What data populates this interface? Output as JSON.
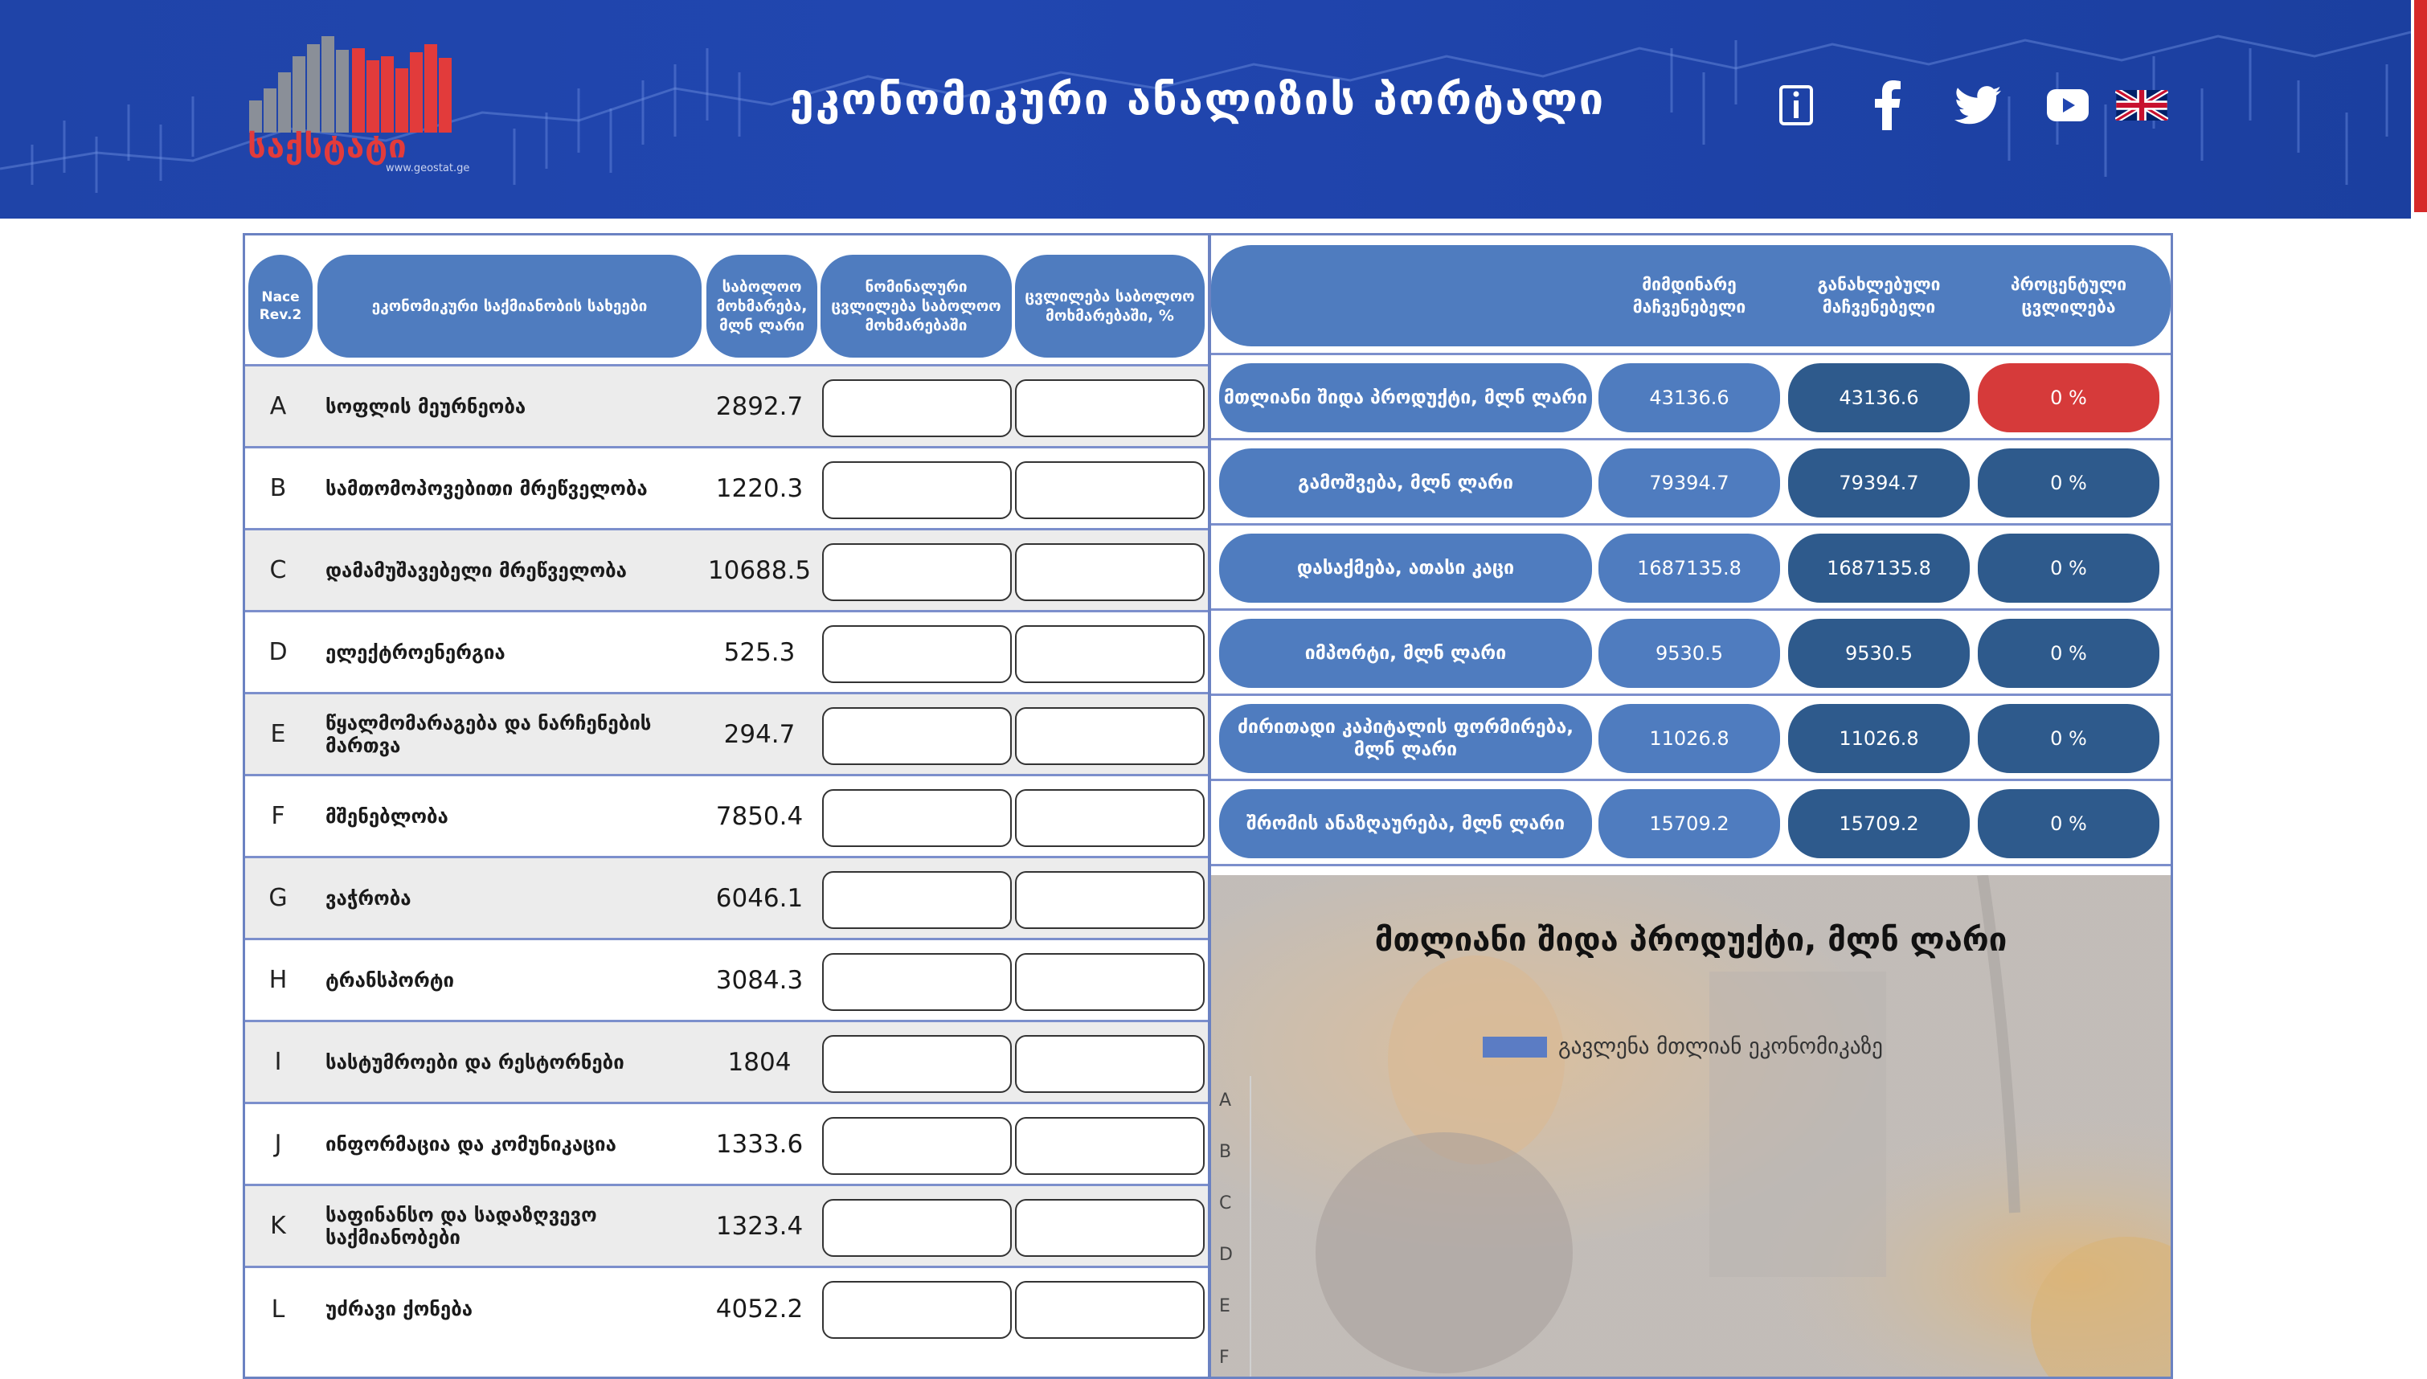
{
  "header": {
    "logo_text": "საქსტატი",
    "logo_url": "www.geostat.ge",
    "title": "ეკონომიკური ანალიზის პორტალი",
    "icons": [
      "info-icon",
      "facebook-icon",
      "twitter-icon",
      "youtube-icon",
      "uk-flag-icon"
    ],
    "colors": {
      "background": "#2146b0",
      "accent_red": "#d62a2a"
    }
  },
  "left_table": {
    "headers": {
      "code": "Nace Rev.2",
      "name": "ეკონომიკური საქმიანობის სახეები",
      "final_consumption": "საბოლოო მოხმარება, მლნ ლარი",
      "nominal_change": "ნომინალური ცვლილება საბოლოო მოხმარებაში",
      "change_pct": "ცვლილება საბოლოო მოხმარებაში, %"
    },
    "rows": [
      {
        "code": "A",
        "name": "სოფლის მეურნეობა",
        "value": "2892.7"
      },
      {
        "code": "B",
        "name": "სამთომოპოვებითი მრეწველობა",
        "value": "1220.3"
      },
      {
        "code": "C",
        "name": "დამამუშავებელი მრეწველობა",
        "value": "10688.5"
      },
      {
        "code": "D",
        "name": "ელექტროენერგია",
        "value": "525.3"
      },
      {
        "code": "E",
        "name": "წყალმომარაგება და ნარჩენების მართვა",
        "value": "294.7"
      },
      {
        "code": "F",
        "name": "მშენებლობა",
        "value": "7850.4"
      },
      {
        "code": "G",
        "name": "ვაჭრობა",
        "value": "6046.1"
      },
      {
        "code": "H",
        "name": "ტრანსპორტი",
        "value": "3084.3"
      },
      {
        "code": "I",
        "name": "სასტუმროები და რესტორნები",
        "value": "1804"
      },
      {
        "code": "J",
        "name": "ინფორმაცია და კომუნიკაცია",
        "value": "1333.6"
      },
      {
        "code": "K",
        "name": "საფინანსო და სადაზღვევო საქმიანობები",
        "value": "1323.4"
      },
      {
        "code": "L",
        "name": "უძრავი ქონება",
        "value": "4052.2"
      }
    ]
  },
  "indicators": {
    "headers": {
      "current": "მიმდინარე მაჩვენებელი",
      "updated": "განახლებული მაჩვენებელი",
      "pct_change": "პროცენტული ცვლილება"
    },
    "rows": [
      {
        "label": "მთლიანი შიდა პროდუქტი, მლნ ლარი",
        "current": "43136.6",
        "updated": "43136.6",
        "pct": "0 %"
      },
      {
        "label": "გამოშვება, მლნ ლარი",
        "current": "79394.7",
        "updated": "79394.7",
        "pct": "0 %"
      },
      {
        "label": "დასაქმება, ათასი კაცი",
        "current": "1687135.8",
        "updated": "1687135.8",
        "pct": "0 %"
      },
      {
        "label": "იმპორტი, მლნ ლარი",
        "current": "9530.5",
        "updated": "9530.5",
        "pct": "0 %"
      },
      {
        "label": "ძირითადი კაპიტალის ფორმირება, მლნ ლარი",
        "current": "11026.8",
        "updated": "11026.8",
        "pct": "0 %"
      },
      {
        "label": "შრომის ანაზღაურება, მლნ ლარი",
        "current": "15709.2",
        "updated": "15709.2",
        "pct": "0 %"
      }
    ],
    "colors": {
      "light": "#4f7cbf",
      "dark": "#2e5a8c",
      "alert": "#d63a3a"
    }
  },
  "chart_data": {
    "type": "bar",
    "title": "მთლიანი შიდა პროდუქტი, მლნ ლარი",
    "series": [
      {
        "name": "გავლენა მთლიან ეკონომიკაზე",
        "values": []
      }
    ],
    "categories": [
      "A",
      "B",
      "C",
      "D",
      "E",
      "F"
    ],
    "color": "#5b7cc4"
  }
}
